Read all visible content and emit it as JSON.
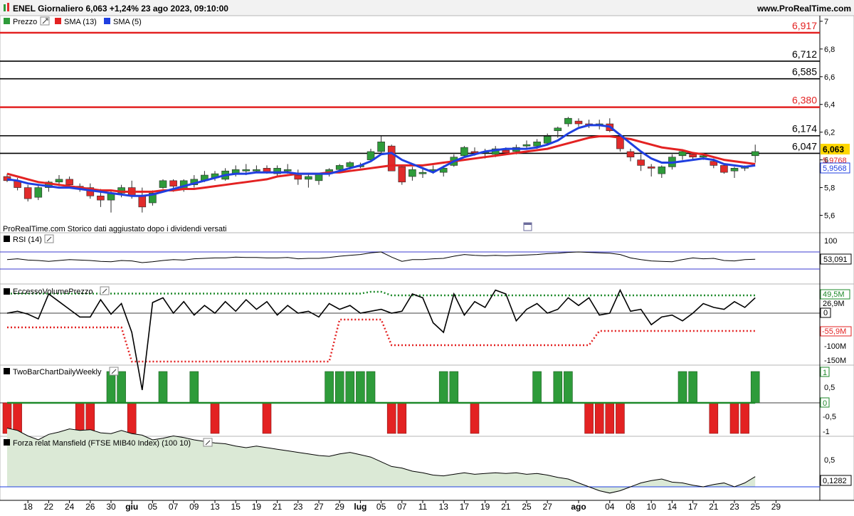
{
  "header": {
    "instrument_line": "ENEL Giornaliero 6,063 +1,24% 23 ago 2023, 09:10:00",
    "site": "www.ProRealTime.com"
  },
  "colors": {
    "up": "#2e9b3a",
    "down": "#e12b2b",
    "sma13": "#e32222",
    "sma5": "#1f3fe0",
    "axis": "#000000",
    "highlight": "#ffd700",
    "mansfield_fill": "#dbe9d6"
  },
  "panels": {
    "price": {
      "legend": [
        {
          "label": "Prezzo",
          "swatch": "#2e9b3a"
        },
        {
          "label": "SMA (13)",
          "swatch": "#e32222"
        },
        {
          "label": "SMA (5)",
          "swatch": "#1f3fe0"
        }
      ],
      "note": "ProRealTime.com Storico dati aggiustato dopo i dividendi versati",
      "y_ticks": [
        "7",
        "6,8",
        "6,6",
        "6,4",
        "6,2",
        "6",
        "5,8",
        "5,6"
      ],
      "price_label": "6,063",
      "sma13_label": "5,9768",
      "sma5_label": "5,9568"
    },
    "rsi": {
      "title": "RSI (14)",
      "ticks": [
        "100"
      ],
      "value_label": "53,091"
    },
    "volume": {
      "title": "EccessoVolumePrezzo",
      "ticks": [
        "-100M",
        "-150M"
      ],
      "labels": [
        "49,5M",
        "26,9M",
        "0",
        "-55,9M"
      ]
    },
    "twobar": {
      "title": "TwoBarChartDailyWeekly",
      "ticks": [
        "1",
        "0,5",
        "0",
        "-0,5",
        "-1"
      ]
    },
    "mansfield": {
      "title": "Forza relat Mansfield (FTSE MIB40 Index) (100 10)",
      "ticks": [
        "0,5"
      ],
      "value_label": "0,1282"
    }
  },
  "x_axis": {
    "labels": [
      {
        "t": "18",
        "i": 2,
        "bold": false
      },
      {
        "t": "22",
        "i": 4,
        "bold": false
      },
      {
        "t": "24",
        "i": 6,
        "bold": false
      },
      {
        "t": "26",
        "i": 8,
        "bold": false
      },
      {
        "t": "30",
        "i": 10,
        "bold": false
      },
      {
        "t": "giu",
        "i": 12,
        "bold": true
      },
      {
        "t": "05",
        "i": 14,
        "bold": false
      },
      {
        "t": "07",
        "i": 16,
        "bold": false
      },
      {
        "t": "09",
        "i": 18,
        "bold": false
      },
      {
        "t": "13",
        "i": 20,
        "bold": false
      },
      {
        "t": "15",
        "i": 22,
        "bold": false
      },
      {
        "t": "19",
        "i": 24,
        "bold": false
      },
      {
        "t": "21",
        "i": 26,
        "bold": false
      },
      {
        "t": "23",
        "i": 28,
        "bold": false
      },
      {
        "t": "27",
        "i": 30,
        "bold": false
      },
      {
        "t": "29",
        "i": 32,
        "bold": false
      },
      {
        "t": "lug",
        "i": 34,
        "bold": true
      },
      {
        "t": "05",
        "i": 36,
        "bold": false
      },
      {
        "t": "07",
        "i": 38,
        "bold": false
      },
      {
        "t": "11",
        "i": 40,
        "bold": false
      },
      {
        "t": "13",
        "i": 42,
        "bold": false
      },
      {
        "t": "17",
        "i": 44,
        "bold": false
      },
      {
        "t": "19",
        "i": 46,
        "bold": false
      },
      {
        "t": "21",
        "i": 48,
        "bold": false
      },
      {
        "t": "25",
        "i": 50,
        "bold": false
      },
      {
        "t": "27",
        "i": 52,
        "bold": false
      },
      {
        "t": "ago",
        "i": 55,
        "bold": true
      },
      {
        "t": "04",
        "i": 58,
        "bold": false
      },
      {
        "t": "08",
        "i": 60,
        "bold": false
      },
      {
        "t": "10",
        "i": 62,
        "bold": false
      },
      {
        "t": "14",
        "i": 64,
        "bold": false
      },
      {
        "t": "17",
        "i": 66,
        "bold": false
      },
      {
        "t": "21",
        "i": 68,
        "bold": false
      },
      {
        "t": "23",
        "i": 70,
        "bold": false
      },
      {
        "t": "25",
        "i": 72,
        "bold": false
      },
      {
        "t": "29",
        "i": 74,
        "bold": false
      }
    ]
  },
  "chart_data": {
    "type": "candlestick",
    "ylim": [
      5.5,
      7.02
    ],
    "horizontal_levels": [
      {
        "value": 6.917,
        "label": "6,917",
        "color": "#e32222"
      },
      {
        "value": 6.712,
        "label": "6,712",
        "color": "#000000"
      },
      {
        "value": 6.585,
        "label": "6,585",
        "color": "#000000"
      },
      {
        "value": 6.38,
        "label": "6,380",
        "color": "#e32222"
      },
      {
        "value": 6.174,
        "label": "6,174",
        "color": "#000000"
      },
      {
        "value": 6.047,
        "label": "6,047",
        "color": "#000000"
      }
    ],
    "candles": [
      [
        5.88,
        5.9,
        5.84,
        5.85
      ],
      [
        5.85,
        5.87,
        5.78,
        5.8
      ],
      [
        5.8,
        5.82,
        5.7,
        5.72
      ],
      [
        5.73,
        5.82,
        5.71,
        5.8
      ],
      [
        5.8,
        5.85,
        5.77,
        5.84
      ],
      [
        5.84,
        5.89,
        5.81,
        5.86
      ],
      [
        5.86,
        5.88,
        5.81,
        5.82
      ],
      [
        5.81,
        5.83,
        5.77,
        5.8
      ],
      [
        5.8,
        5.83,
        5.72,
        5.74
      ],
      [
        5.74,
        5.79,
        5.66,
        5.71
      ],
      [
        5.71,
        5.78,
        5.62,
        5.76
      ],
      [
        5.76,
        5.82,
        5.73,
        5.8
      ],
      [
        5.8,
        5.85,
        5.72,
        5.74
      ],
      [
        5.74,
        5.8,
        5.62,
        5.66
      ],
      [
        5.69,
        5.78,
        5.67,
        5.76
      ],
      [
        5.8,
        5.86,
        5.79,
        5.85
      ],
      [
        5.85,
        5.86,
        5.77,
        5.81
      ],
      [
        5.79,
        5.86,
        5.77,
        5.85
      ],
      [
        5.82,
        5.89,
        5.8,
        5.86
      ],
      [
        5.85,
        5.92,
        5.84,
        5.89
      ],
      [
        5.87,
        5.92,
        5.85,
        5.9
      ],
      [
        5.86,
        5.94,
        5.85,
        5.92
      ],
      [
        5.9,
        5.96,
        5.88,
        5.93
      ],
      [
        5.92,
        5.97,
        5.89,
        5.93
      ],
      [
        5.93,
        5.96,
        5.91,
        5.93
      ],
      [
        5.94,
        5.96,
        5.9,
        5.91
      ],
      [
        5.9,
        5.96,
        5.88,
        5.94
      ],
      [
        5.92,
        5.97,
        5.9,
        5.93
      ],
      [
        5.89,
        5.93,
        5.82,
        5.86
      ],
      [
        5.86,
        5.9,
        5.8,
        5.88
      ],
      [
        5.85,
        5.9,
        5.82,
        5.9
      ],
      [
        5.9,
        5.94,
        5.88,
        5.93
      ],
      [
        5.93,
        5.97,
        5.91,
        5.96
      ],
      [
        5.95,
        5.99,
        5.93,
        5.98
      ],
      [
        5.96,
        5.98,
        5.94,
        5.96
      ],
      [
        6.0,
        6.08,
        5.99,
        6.06
      ],
      [
        6.06,
        6.17,
        6.05,
        6.13
      ],
      [
        6.1,
        6.11,
        5.93,
        5.92
      ],
      [
        5.95,
        5.96,
        5.82,
        5.84
      ],
      [
        5.88,
        5.95,
        5.85,
        5.93
      ],
      [
        5.9,
        5.95,
        5.87,
        5.91
      ],
      [
        5.93,
        5.96,
        5.9,
        5.93
      ],
      [
        5.91,
        5.96,
        5.88,
        5.94
      ],
      [
        5.96,
        6.04,
        5.95,
        6.02
      ],
      [
        6.03,
        6.1,
        6.02,
        6.09
      ],
      [
        6.06,
        6.09,
        6.03,
        6.05
      ],
      [
        6.05,
        6.08,
        6.01,
        6.06
      ],
      [
        6.04,
        6.1,
        6.02,
        6.08
      ],
      [
        6.07,
        6.09,
        6.04,
        6.05
      ],
      [
        6.06,
        6.11,
        6.04,
        6.09
      ],
      [
        6.1,
        6.14,
        6.08,
        6.11
      ],
      [
        6.1,
        6.15,
        6.08,
        6.13
      ],
      [
        6.12,
        6.19,
        6.11,
        6.17
      ],
      [
        6.21,
        6.24,
        6.16,
        6.23
      ],
      [
        6.26,
        6.31,
        6.24,
        6.3
      ],
      [
        6.28,
        6.3,
        6.24,
        6.26
      ],
      [
        6.26,
        6.29,
        6.23,
        6.25
      ],
      [
        6.25,
        6.29,
        6.22,
        6.26
      ],
      [
        6.26,
        6.3,
        6.2,
        6.21
      ],
      [
        6.17,
        6.19,
        6.06,
        6.08
      ],
      [
        6.06,
        6.08,
        5.99,
        6.02
      ],
      [
        6.0,
        6.04,
        5.92,
        5.96
      ],
      [
        5.95,
        5.97,
        5.88,
        5.94
      ],
      [
        5.9,
        5.96,
        5.87,
        5.95
      ],
      [
        5.95,
        6.04,
        5.93,
        6.02
      ],
      [
        6.03,
        6.07,
        6.0,
        6.06
      ],
      [
        6.04,
        6.05,
        6.0,
        6.02
      ],
      [
        6.02,
        6.05,
        6.0,
        6.03
      ],
      [
        5.99,
        6.01,
        5.94,
        5.96
      ],
      [
        5.96,
        5.97,
        5.9,
        5.91
      ],
      [
        5.92,
        5.95,
        5.87,
        5.94
      ],
      [
        5.94,
        5.96,
        5.92,
        5.95
      ],
      [
        6.03,
        6.11,
        5.98,
        6.06
      ]
    ],
    "sma13": [
      5.9,
      5.88,
      5.86,
      5.84,
      5.83,
      5.82,
      5.81,
      5.8,
      5.79,
      5.78,
      5.78,
      5.77,
      5.77,
      5.77,
      5.77,
      5.78,
      5.78,
      5.79,
      5.79,
      5.8,
      5.81,
      5.82,
      5.83,
      5.84,
      5.85,
      5.86,
      5.88,
      5.89,
      5.9,
      5.9,
      5.9,
      5.91,
      5.91,
      5.92,
      5.93,
      5.94,
      5.95,
      5.96,
      5.96,
      5.96,
      5.96,
      5.97,
      5.98,
      5.99,
      6.0,
      6.01,
      6.02,
      6.03,
      6.04,
      6.05,
      6.06,
      6.07,
      6.08,
      6.1,
      6.12,
      6.14,
      6.16,
      6.17,
      6.17,
      6.16,
      6.15,
      6.13,
      6.11,
      6.09,
      6.08,
      6.07,
      6.05,
      6.04,
      6.02,
      6.0,
      5.99,
      5.98,
      5.97
    ],
    "sma5": [
      5.86,
      5.85,
      5.83,
      5.82,
      5.81,
      5.8,
      5.8,
      5.79,
      5.78,
      5.77,
      5.76,
      5.75,
      5.74,
      5.74,
      5.75,
      5.77,
      5.79,
      5.81,
      5.83,
      5.85,
      5.87,
      5.89,
      5.9,
      5.9,
      5.91,
      5.91,
      5.91,
      5.91,
      5.9,
      5.9,
      5.9,
      5.9,
      5.92,
      5.94,
      5.96,
      5.99,
      6.04,
      6.05,
      6.0,
      5.97,
      5.94,
      5.91,
      5.95,
      5.99,
      6.02,
      6.04,
      6.06,
      6.07,
      6.08,
      6.08,
      6.08,
      6.09,
      6.11,
      6.14,
      6.19,
      6.23,
      6.25,
      6.25,
      6.24,
      6.18,
      6.12,
      6.06,
      6.01,
      5.98,
      5.98,
      5.99,
      6.0,
      6.01,
      6.0,
      5.97,
      5.96,
      5.95,
      5.96
    ],
    "rsi": [
      52,
      54,
      51,
      50,
      48,
      50,
      52,
      51,
      50,
      48,
      47,
      50,
      49,
      45,
      47,
      50,
      52,
      51,
      54,
      55,
      56,
      56,
      58,
      57,
      57,
      56,
      56,
      57,
      54,
      55,
      55,
      57,
      60,
      62,
      64,
      68,
      70,
      58,
      48,
      52,
      52,
      54,
      55,
      60,
      64,
      62,
      61,
      62,
      61,
      62,
      63,
      64,
      66,
      67,
      69,
      70,
      69,
      68,
      67,
      64,
      56,
      52,
      49,
      48,
      47,
      52,
      56,
      54,
      55,
      50,
      49,
      52,
      53
    ],
    "volume_line": [
      0,
      10,
      -5,
      -30,
      100,
      60,
      20,
      -20,
      -20,
      70,
      -5,
      50,
      -100,
      -400,
      55,
      80,
      0,
      60,
      -10,
      40,
      0,
      60,
      10,
      70,
      20,
      60,
      -10,
      40,
      0,
      10,
      -20,
      50,
      20,
      40,
      0,
      10,
      20,
      0,
      10,
      100,
      80,
      -50,
      -100,
      100,
      -10,
      60,
      30,
      120,
      100,
      -40,
      20,
      50,
      0,
      20,
      80,
      40,
      80,
      -10,
      0,
      120,
      10,
      20,
      -60,
      -20,
      -10,
      -40,
      0,
      50,
      30,
      20,
      60,
      30,
      80
    ],
    "volume_upper": [
      55,
      55,
      55,
      55,
      55,
      55,
      55,
      55,
      55,
      55,
      55,
      55,
      55,
      55,
      55,
      55,
      55,
      55,
      55,
      55,
      55,
      55,
      55,
      55,
      55,
      55,
      55,
      55,
      55,
      55,
      55,
      55,
      55,
      55,
      55,
      60,
      60,
      50,
      50,
      50,
      50,
      50,
      50,
      50,
      50,
      50,
      50,
      50,
      50,
      50,
      50,
      50,
      50,
      50,
      50,
      50,
      50,
      50,
      50,
      50,
      50,
      50,
      50,
      50,
      50,
      50,
      50,
      50,
      50,
      50,
      50,
      50,
      50
    ],
    "volume_lower": [
      -140,
      -140,
      -140,
      -140,
      -140,
      -140,
      -140,
      -140,
      -140,
      -140,
      -140,
      -140,
      -140,
      -400,
      -400,
      -400,
      -400,
      -400,
      -400,
      -400,
      -400,
      -400,
      -400,
      -400,
      -400,
      -400,
      -400,
      -400,
      -400,
      -400,
      -400,
      -400,
      -400,
      -400,
      -400,
      -400,
      -400,
      -400,
      -400,
      -400,
      -400,
      -400,
      -400,
      -400,
      -400,
      -400,
      -400,
      -400,
      -400,
      -400,
      -400,
      -400,
      -400,
      -400,
      -400,
      -400,
      -400,
      -400,
      -400,
      -400,
      -400,
      -400,
      -400,
      -400,
      -400,
      -400,
      -400,
      -400,
      -400,
      -400,
      -400,
      -400,
      -400
    ],
    "twobar_bars": [
      -1,
      -1,
      0,
      0,
      0,
      0,
      0,
      -1,
      -1,
      0,
      1,
      1,
      -1,
      0,
      0,
      1,
      0,
      0,
      1,
      0,
      -1,
      0,
      0,
      0,
      0,
      -1,
      0,
      0,
      0,
      0,
      0,
      1,
      1,
      1,
      1,
      1,
      0,
      -1,
      -1,
      0,
      0,
      0,
      1,
      1,
      0,
      -1,
      0,
      0,
      0,
      0,
      0,
      1,
      0,
      1,
      1,
      0,
      -1,
      -1,
      -1,
      -1,
      0,
      0,
      0,
      0,
      0,
      1,
      1,
      0,
      -1,
      0,
      -1,
      -1,
      1
    ],
    "twobar_line": [
      0,
      0,
      0,
      0,
      0,
      0,
      0,
      0,
      0,
      0,
      0,
      0,
      0,
      0,
      0,
      0,
      0,
      0,
      0,
      0,
      0,
      0,
      0,
      0,
      0,
      0,
      0,
      0,
      0,
      0,
      0,
      0,
      0,
      0,
      0,
      0,
      0,
      0,
      0,
      0,
      0,
      0,
      0,
      0,
      0,
      0,
      0,
      0,
      0,
      0,
      0,
      0,
      0,
      0,
      0,
      0,
      0,
      0,
      0,
      0,
      0,
      0,
      0,
      0,
      0,
      0,
      0,
      0,
      0,
      0,
      0,
      0,
      0
    ],
    "mansfield": [
      0.75,
      0.72,
      0.65,
      0.6,
      0.67,
      0.7,
      0.74,
      0.72,
      0.73,
      0.69,
      0.68,
      0.72,
      0.68,
      0.66,
      0.6,
      0.62,
      0.65,
      0.63,
      0.6,
      0.58,
      0.56,
      0.55,
      0.52,
      0.5,
      0.52,
      0.5,
      0.48,
      0.46,
      0.44,
      0.42,
      0.4,
      0.39,
      0.42,
      0.44,
      0.41,
      0.38,
      0.32,
      0.26,
      0.24,
      0.2,
      0.18,
      0.15,
      0.14,
      0.16,
      0.18,
      0.16,
      0.17,
      0.18,
      0.17,
      0.18,
      0.16,
      0.17,
      0.15,
      0.12,
      0.1,
      0.05,
      0.0,
      -0.05,
      -0.08,
      -0.05,
      0.0,
      0.05,
      0.08,
      0.1,
      0.06,
      0.05,
      0.02,
      0.0,
      0.03,
      0.05,
      0.0,
      0.05,
      0.13
    ]
  }
}
